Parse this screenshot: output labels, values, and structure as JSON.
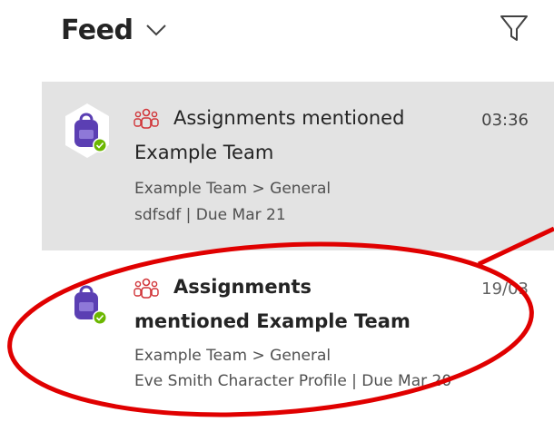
{
  "header": {
    "title": "Feed"
  },
  "icons": {
    "chevron": "chevron-down-icon",
    "filter": "filter-icon",
    "assignments_app": "assignments-backpack-icon",
    "status": "available-status-icon",
    "team": "team-icon"
  },
  "colors": {
    "selected_card": "#e3e3e3",
    "assignments_purple": "#5b3fb3",
    "team_icon_red": "#d13438",
    "status_green": "#6bb700",
    "annotation_red": "#e00000"
  },
  "feed": {
    "items": [
      {
        "activity": "Assignments mentioned",
        "team": "Example Team",
        "time": "03:36",
        "path": "Example Team > General",
        "detail": "sdfsdf | Due Mar 21"
      },
      {
        "activity_line1": "Assignments",
        "activity_line2": "mentioned Example Team",
        "time": "19/03",
        "path": "Example Team > General",
        "detail": "Eve Smith Character Profile | Due Mar 20"
      }
    ]
  }
}
